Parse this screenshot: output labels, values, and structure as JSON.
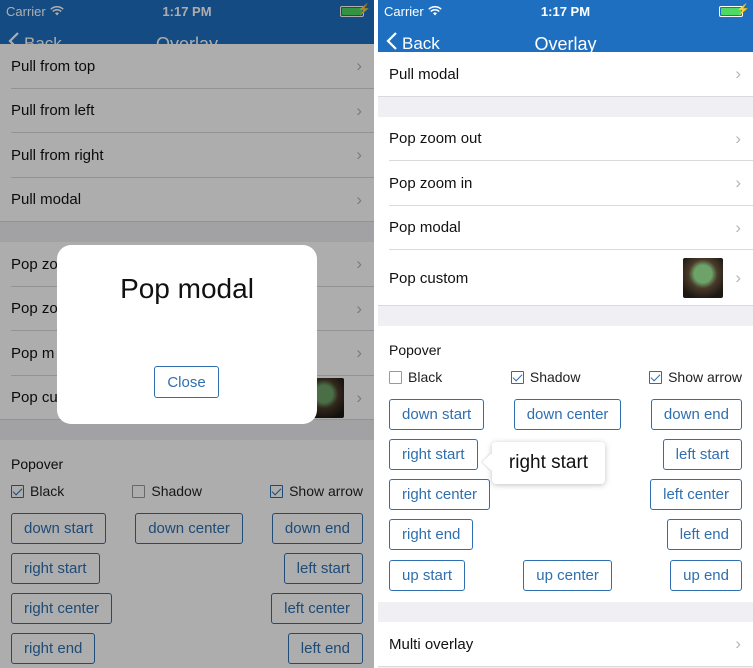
{
  "status": {
    "carrier": "Carrier",
    "time": "1:17 PM"
  },
  "nav": {
    "back_label": "Back",
    "title": "Overlay"
  },
  "left_screen": {
    "pull_rows": [
      "Pull from top",
      "Pull from left",
      "Pull from right",
      "Pull modal"
    ],
    "pop_rows": [
      "Pop zoom out",
      "Pop zoom in",
      "Pop modal",
      "Pop custom"
    ],
    "pop_rows_visible": [
      "Pop zo",
      "Pop zo",
      "Pop m",
      "Pop cu"
    ],
    "popover": {
      "title": "Popover",
      "checks": [
        {
          "label": "Black",
          "checked": true
        },
        {
          "label": "Shadow",
          "checked": false
        },
        {
          "label": "Show arrow",
          "checked": true
        }
      ],
      "buttons": [
        "down start",
        "down center",
        "down end",
        "right start",
        "left start",
        "right center",
        "left center",
        "right end",
        "left end"
      ]
    },
    "modal": {
      "title": "Pop modal",
      "close_label": "Close"
    }
  },
  "right_screen": {
    "pull_rows": [
      "Pull modal"
    ],
    "pop_rows": [
      "Pop zoom out",
      "Pop zoom in",
      "Pop modal",
      "Pop custom"
    ],
    "popover": {
      "title": "Popover",
      "checks": [
        {
          "label": "Black",
          "checked": false
        },
        {
          "label": "Shadow",
          "checked": true
        },
        {
          "label": "Show arrow",
          "checked": true
        }
      ],
      "buttons": [
        "down start",
        "down center",
        "down end",
        "right start",
        "left start",
        "right center",
        "left center",
        "right end",
        "left end",
        "up start",
        "up center",
        "up end"
      ]
    },
    "tooltip": "right start",
    "bottom_rows": [
      "Multi overlay"
    ]
  },
  "colors": {
    "nav_bg": "#1f6fc1",
    "accent": "#2f6fb0",
    "battery": "#4cd964"
  }
}
